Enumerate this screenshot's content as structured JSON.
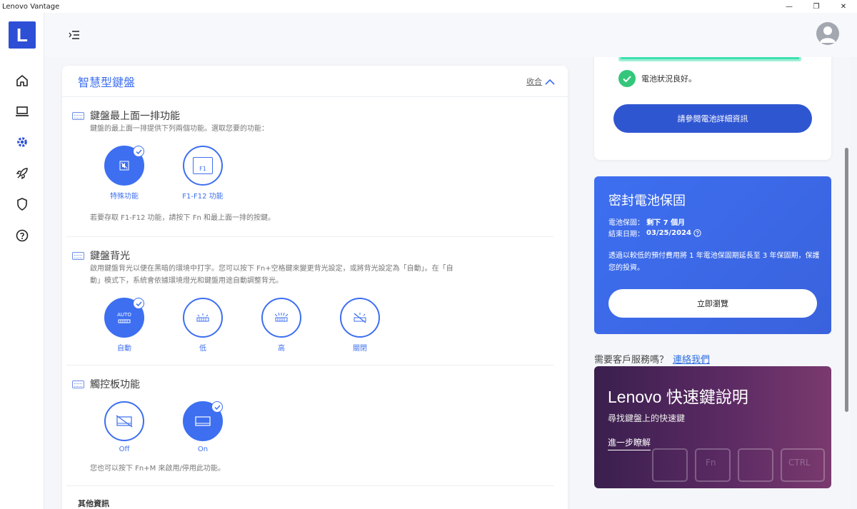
{
  "window": {
    "title": "Lenovo Vantage",
    "controls": {
      "minimize": "—",
      "maximize": "❐",
      "close": "✕"
    }
  },
  "sidebar": {
    "logo": "L",
    "items": [
      {
        "icon": "home-icon"
      },
      {
        "icon": "laptop-icon"
      },
      {
        "icon": "gear-icon"
      },
      {
        "icon": "rocket-icon"
      },
      {
        "icon": "shield-icon"
      },
      {
        "icon": "help-icon"
      }
    ]
  },
  "header": {
    "menu_icon": "menu-collapse-icon",
    "avatar_icon": "user-avatar-icon"
  },
  "smart_keyboard": {
    "title": "智慧型鍵盤",
    "collapse_label": "收合",
    "top_row": {
      "title": "鍵盤最上面一排功能",
      "desc": "鍵盤的最上面一排提供下列兩個功能。選取您要的功能：",
      "options": [
        {
          "label": "特殊功能",
          "selected": true
        },
        {
          "label": "F1-F12 功能",
          "selected": false,
          "key_text": "F1"
        }
      ],
      "note": "若要存取 F1-F12 功能，請按下 Fn 和最上面一排的按鍵。"
    },
    "backlight": {
      "title": "鍵盤背光",
      "desc_line1": "啟用鍵盤背光以便在黑暗的環境中打字。您可以按下 Fn+空格鍵來變更背光設定，或將背光設定為「自動」。在「自",
      "desc_line2": "動」模式下，系統會依據環境燈光和鍵盤用途自動調整背光。",
      "options": [
        {
          "label": "自動",
          "selected": true,
          "badge": "AUTO"
        },
        {
          "label": "低",
          "selected": false
        },
        {
          "label": "高",
          "selected": false
        },
        {
          "label": "關閉",
          "selected": false
        }
      ]
    },
    "touchpad": {
      "title": "觸控板功能",
      "options": [
        {
          "label": "Off",
          "selected": false
        },
        {
          "label": "On",
          "selected": true
        }
      ],
      "note": "您也可以按下 Fn+M 來啟用/停用此功能。"
    },
    "other_info": "其他資訊"
  },
  "battery": {
    "status": "電池狀況良好。",
    "details_button": "請參閱電池詳細資訊"
  },
  "warranty": {
    "title": "密封電池保固",
    "warranty_label": "電池保固：",
    "warranty_value": "剩下 7 個月",
    "end_label": "結束日期：",
    "end_value": "03/25/2024",
    "desc": "透過以較低的預付費用將 1 年電池保固期延長至 3 年保固期，保護您的投資。",
    "button": "立即瀏覽"
  },
  "support": {
    "question": "需要客戶服務嗎？",
    "link": "連絡我們"
  },
  "promo": {
    "title": "Lenovo 快速鍵說明",
    "subtitle": "尋找鍵盤上的快速鍵",
    "link": "進一步瞭解",
    "key_caps": [
      "Fn",
      "CTRL"
    ]
  },
  "colors": {
    "accent": "#3d6ff0",
    "logo": "#2d4fd6",
    "good": "#34c77b"
  }
}
